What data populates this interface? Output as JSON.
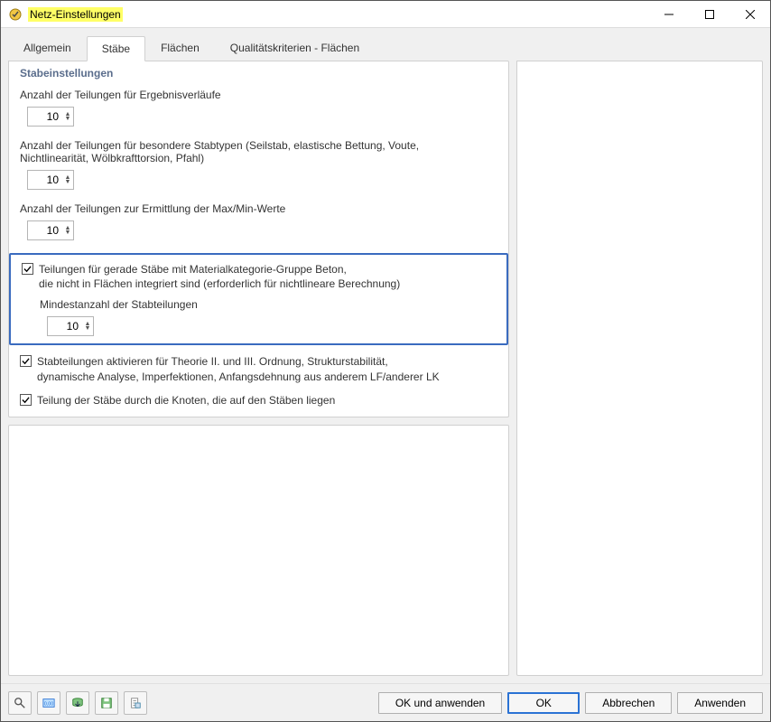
{
  "window": {
    "title": "Netz-Einstellungen"
  },
  "tabs": {
    "allgemein": "Allgemein",
    "stabe": "Stäbe",
    "flachen": "Flächen",
    "qualitatskriterien": "Qualitätskriterien - Flächen"
  },
  "panel": {
    "title": "Stabeinstellungen",
    "div_results_label": "Anzahl der Teilungen für Ergebnisverläufe",
    "div_results_value": "10",
    "div_special_label": "Anzahl der Teilungen für besondere Stabtypen (Seilstab, elastische Bettung, Voute, Nichtlinearität, Wölbkrafttorsion, Pfahl)",
    "div_special_value": "10",
    "div_maxmin_label": "Anzahl der Teilungen zur Ermittlung der Max/Min-Werte",
    "div_maxmin_value": "10",
    "chk_concrete_label": "Teilungen für gerade Stäbe mit Materialkategorie-Gruppe Beton,\ndie nicht in Flächen integriert sind (erforderlich für nichtlineare Berechnung)",
    "min_div_label": "Mindestanzahl der Stabteilungen",
    "min_div_value": "10",
    "chk_activate_label": "Stabteilungen aktivieren für Theorie II. und III. Ordnung, Strukturstabilität,\ndynamische Analyse, Imperfektionen, Anfangsdehnung aus anderem LF/anderer LK",
    "chk_nodes_label": "Teilung der Stäbe durch die Knoten, die auf den Stäben liegen"
  },
  "footer": {
    "ok_apply": "OK und anwenden",
    "ok": "OK",
    "cancel": "Abbrechen",
    "apply": "Anwenden"
  }
}
